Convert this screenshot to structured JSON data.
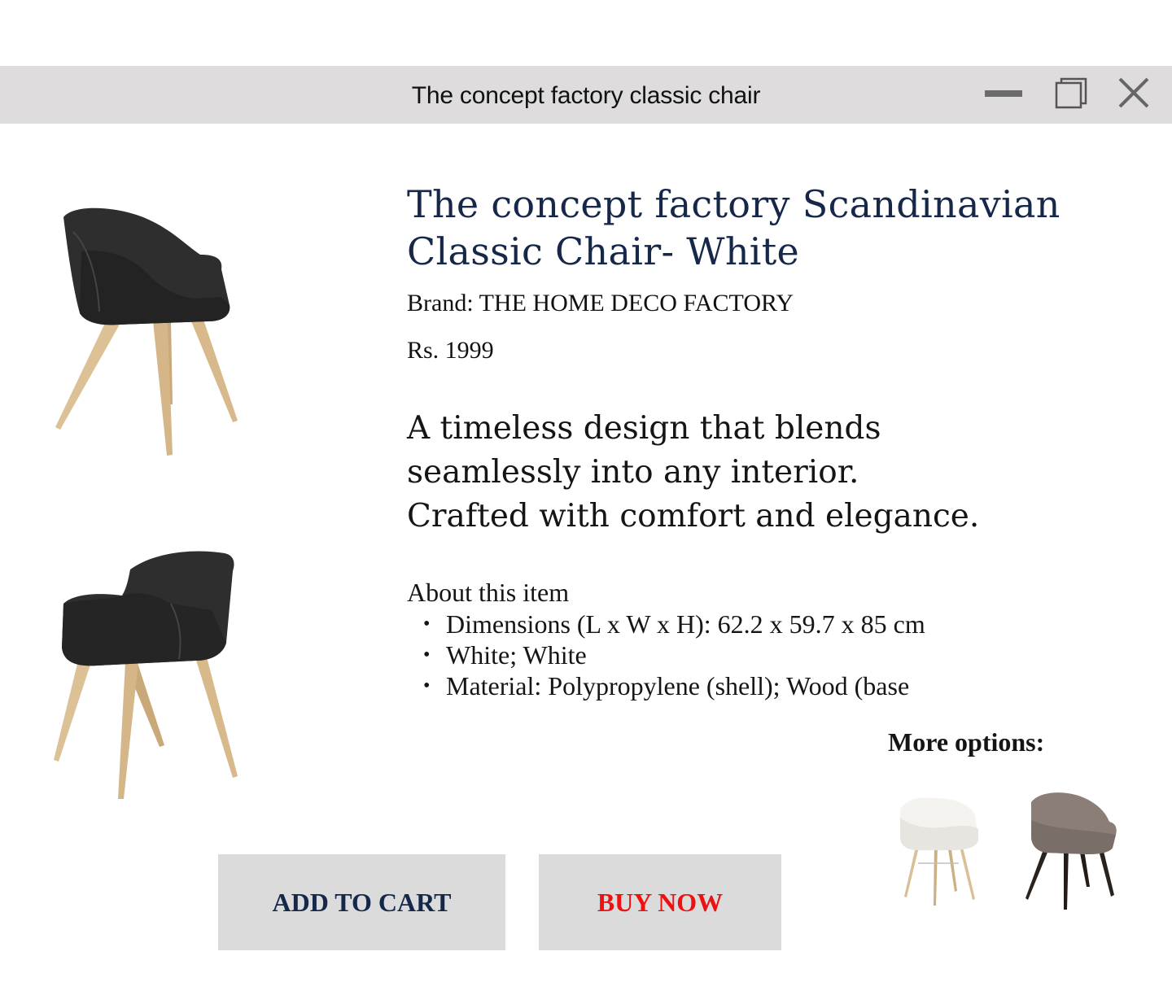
{
  "window": {
    "title": "The concept factory classic chair"
  },
  "product": {
    "title": "The concept factory Scandinavian Classic Chair- White",
    "brand": "Brand: THE HOME DECO FACTORY",
    "price": "Rs. 1999",
    "description_lines": [
      "A timeless design that blends",
      "seamlessly into any interior.",
      "Crafted with comfort and elegance."
    ]
  },
  "about": {
    "heading": "About this item",
    "items": [
      "Dimensions (L x W x H): 62.2 x 59.7 x 85 cm",
      "White; White",
      "Material: Polypropylene (shell); Wood (base"
    ]
  },
  "more_options": {
    "label": "More options:"
  },
  "actions": {
    "add_to_cart": "ADD TO CART",
    "buy_now": "BUY NOW"
  },
  "colors": {
    "titlebar": "#dedcdd",
    "title_navy": "#16284a",
    "buy_now_red": "#ee1111",
    "button_bg": "#dcdbdc"
  },
  "icons": [
    "minimize-icon",
    "maximize-icon",
    "close-icon",
    "bullet-icon"
  ]
}
